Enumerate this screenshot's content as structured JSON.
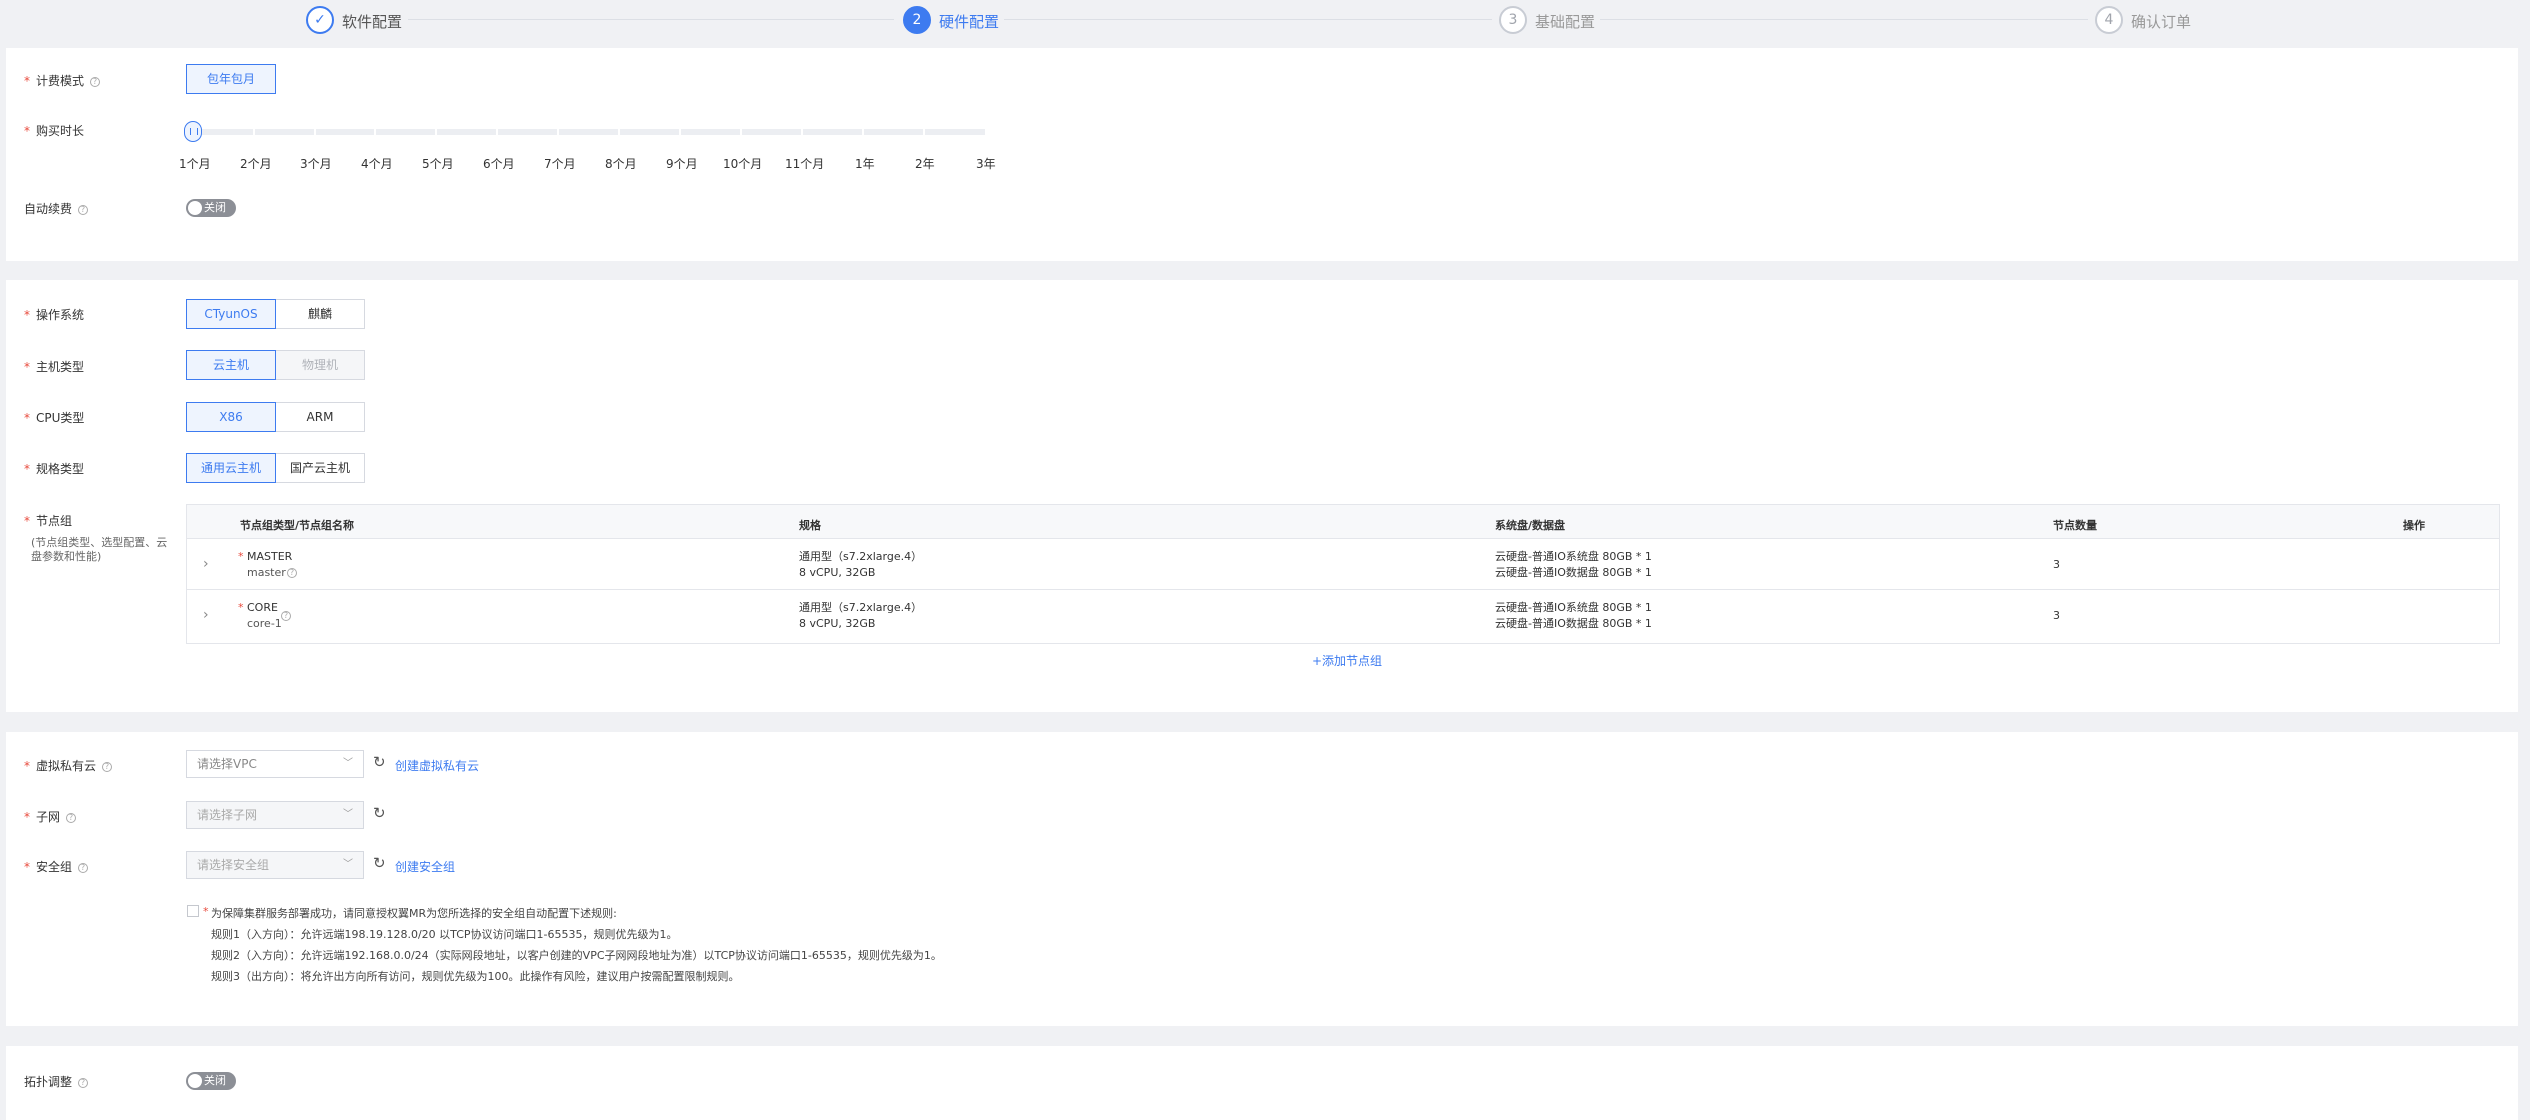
{
  "steps": [
    {
      "label": "软件配置",
      "state": "done"
    },
    {
      "number": "2",
      "label": "硬件配置",
      "state": "active"
    },
    {
      "number": "3",
      "label": "基础配置",
      "state": "pending"
    },
    {
      "number": "4",
      "label": "确认订单",
      "state": "pending"
    }
  ],
  "billing": {
    "billing_mode_label": "计费模式",
    "billing_mode_option": "包年包月",
    "duration_label": "购买时长",
    "duration_options": [
      "1个月",
      "2个月",
      "3个月",
      "4个月",
      "5个月",
      "6个月",
      "7个月",
      "8个月",
      "9个月",
      "10个月",
      "11个月",
      "1年",
      "2年",
      "3年"
    ],
    "duration_selected": "1个月",
    "auto_renew_label": "自动续费",
    "auto_renew_value": "关闭"
  },
  "hardware": {
    "os_label": "操作系统",
    "os_options": [
      "CTyunOS",
      "麒麟"
    ],
    "os_selected": "CTyunOS",
    "host_type_label": "主机类型",
    "host_type_options": [
      "云主机",
      "物理机"
    ],
    "host_type_selected": "云主机",
    "cpu_type_label": "CPU类型",
    "cpu_type_options": [
      "X86",
      "ARM"
    ],
    "cpu_type_selected": "X86",
    "spec_type_label": "规格类型",
    "spec_type_options": [
      "通用云主机",
      "国产云主机"
    ],
    "spec_type_selected": "通用云主机",
    "node_group_label": "节点组",
    "node_group_hint": [
      "(节点组类型、选型配置、云",
      "盘参数和性能)"
    ],
    "table": {
      "headers": [
        "节点组类型/节点组名称",
        "规格",
        "系统盘/数据盘",
        "节点数量",
        "操作"
      ],
      "rows": [
        {
          "type": "MASTER",
          "name": "master",
          "spec_line1": "通用型（s7.2xlarge.4）",
          "spec_line2": "8 vCPU, 32GB",
          "disk_line1": "云硬盘-普通IO系统盘 80GB * 1",
          "disk_line2": "云硬盘-普通IO数据盘 80GB * 1",
          "count": "3"
        },
        {
          "type": "CORE",
          "name": "core-1",
          "spec_line1": "通用型（s7.2xlarge.4）",
          "spec_line2": "8 vCPU, 32GB",
          "disk_line1": "云硬盘-普通IO系统盘 80GB * 1",
          "disk_line2": "云硬盘-普通IO数据盘 80GB * 1",
          "count": "3"
        }
      ]
    },
    "add_node_group": "+添加节点组"
  },
  "network": {
    "vpc_label": "虚拟私有云",
    "vpc_placeholder": "请选择VPC",
    "create_vpc": "创建虚拟私有云",
    "subnet_label": "子网",
    "subnet_placeholder": "请选择子网",
    "security_group_label": "安全组",
    "security_group_placeholder": "请选择安全组",
    "create_security_group": "创建安全组",
    "rules_intro": "为保障集群服务部署成功，请同意授权翼MR为您所选择的安全组自动配置下述规则:",
    "rules": [
      "规则1（入方向）：允许远端198.19.128.0/20 以TCP协议访问端口1-65535，规则优先级为1。",
      "规则2（入方向）：允许远端192.168.0.0/24（实际网段地址，以客户创建的VPC子网网段地址为准）以TCP协议访问端口1-65535，规则优先级为1。",
      "规则3（出方向）：将允许出方向所有访问，规则优先级为100。此操作有风险，建议用户按需配置限制规则。"
    ]
  },
  "topology": {
    "label": "拓扑调整",
    "value": "关闭"
  },
  "colors": {
    "accent": "#3d7bf0",
    "required": "#e84a3c",
    "background": "#f0f1f4"
  }
}
